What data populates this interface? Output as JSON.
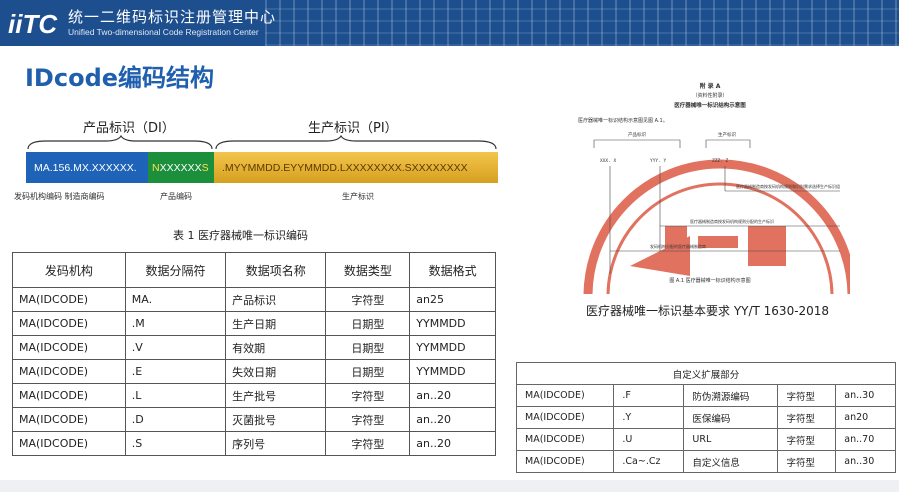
{
  "header": {
    "title_cn": "统一二维码标识注册管理中心",
    "title_en": "Unified Two-dimensional Code Registration Center",
    "logo_text": "iiTC"
  },
  "page_title": "IDcode编码结构",
  "structure": {
    "di_label": "产品标识（DI）",
    "pi_label": "生产标识（PI）",
    "seg_blue": "MA.156.MX.XXXXXX.",
    "seg_green_n": "N",
    "seg_green_x": "XXXXXX",
    "seg_green_s": "S",
    "seg_gold": ".MYYMMDD.EYYMMDD.LXXXXXXXX.SXXXXXXXX",
    "sub_labels": [
      "发码机构编码 制造商编码",
      "产品编码",
      "生产标识"
    ]
  },
  "table1": {
    "caption": "表 1  医疗器械唯一标识编码",
    "headers": [
      "发码机构",
      "数据分隔符",
      "数据项名称",
      "数据类型",
      "数据格式"
    ],
    "rows": [
      [
        "MA(IDCODE)",
        "MA.",
        "产品标识",
        "字符型",
        "an25"
      ],
      [
        "MA(IDCODE)",
        ".M",
        "生产日期",
        "日期型",
        "YYMMDD"
      ],
      [
        "MA(IDCODE)",
        ".V",
        "有效期",
        "日期型",
        "YYMMDD"
      ],
      [
        "MA(IDCODE)",
        ".E",
        "失效日期",
        "日期型",
        "YYMMDD"
      ],
      [
        "MA(IDCODE)",
        ".L",
        "生产批号",
        "字符型",
        "an..20"
      ],
      [
        "MA(IDCODE)",
        ".D",
        "灭菌批号",
        "字符型",
        "an..20"
      ],
      [
        "MA(IDCODE)",
        ".S",
        "序列号",
        "字符型",
        "an..20"
      ]
    ]
  },
  "document": {
    "appendix": "附 录 A",
    "appendix_note": "（资料性附录）",
    "doc_heading": "医疗器械唯一标识结构示意图",
    "doc_line": "医疗器械唯一标识结构示意图见图 A.1。",
    "di": "产品标识",
    "pi": "生产标识",
    "code1": "XXX. X",
    "code2": "YYY. Y",
    "code3": "ZZZ. Z",
    "note1": "医疗器械制造商按发码机构规则和识别需求选择生产标识组",
    "note2": "医疗器械制造商按发码机构规则分配的生产标识",
    "note3": "发码机构分配的医疗器械制造商",
    "fig": "图 A.1  医疗器械唯一标识结构示意图",
    "caption": "医疗器械唯一标识基本要求 YY/T 1630-2018"
  },
  "table2": {
    "title": "自定义扩展部分",
    "rows": [
      [
        "MA(IDCODE)",
        ".F",
        "防伪溯源编码",
        "字符型",
        "an..30"
      ],
      [
        "MA(IDCODE)",
        ".Y",
        "医保编码",
        "字符型",
        "an20"
      ],
      [
        "MA(IDCODE)",
        ".U",
        "URL",
        "字符型",
        "an..70"
      ],
      [
        "MA(IDCODE)",
        ".Ca~.Cz",
        "自定义信息",
        "字符型",
        "an..30"
      ]
    ]
  },
  "colors": {
    "header_bg": "#1d4f8f",
    "title_blue": "#1f5fae",
    "seg_blue": "#1f63b8",
    "seg_green": "#1c8f3c",
    "seg_gold": "#e2b032",
    "watermark_red": "#d9432c"
  }
}
